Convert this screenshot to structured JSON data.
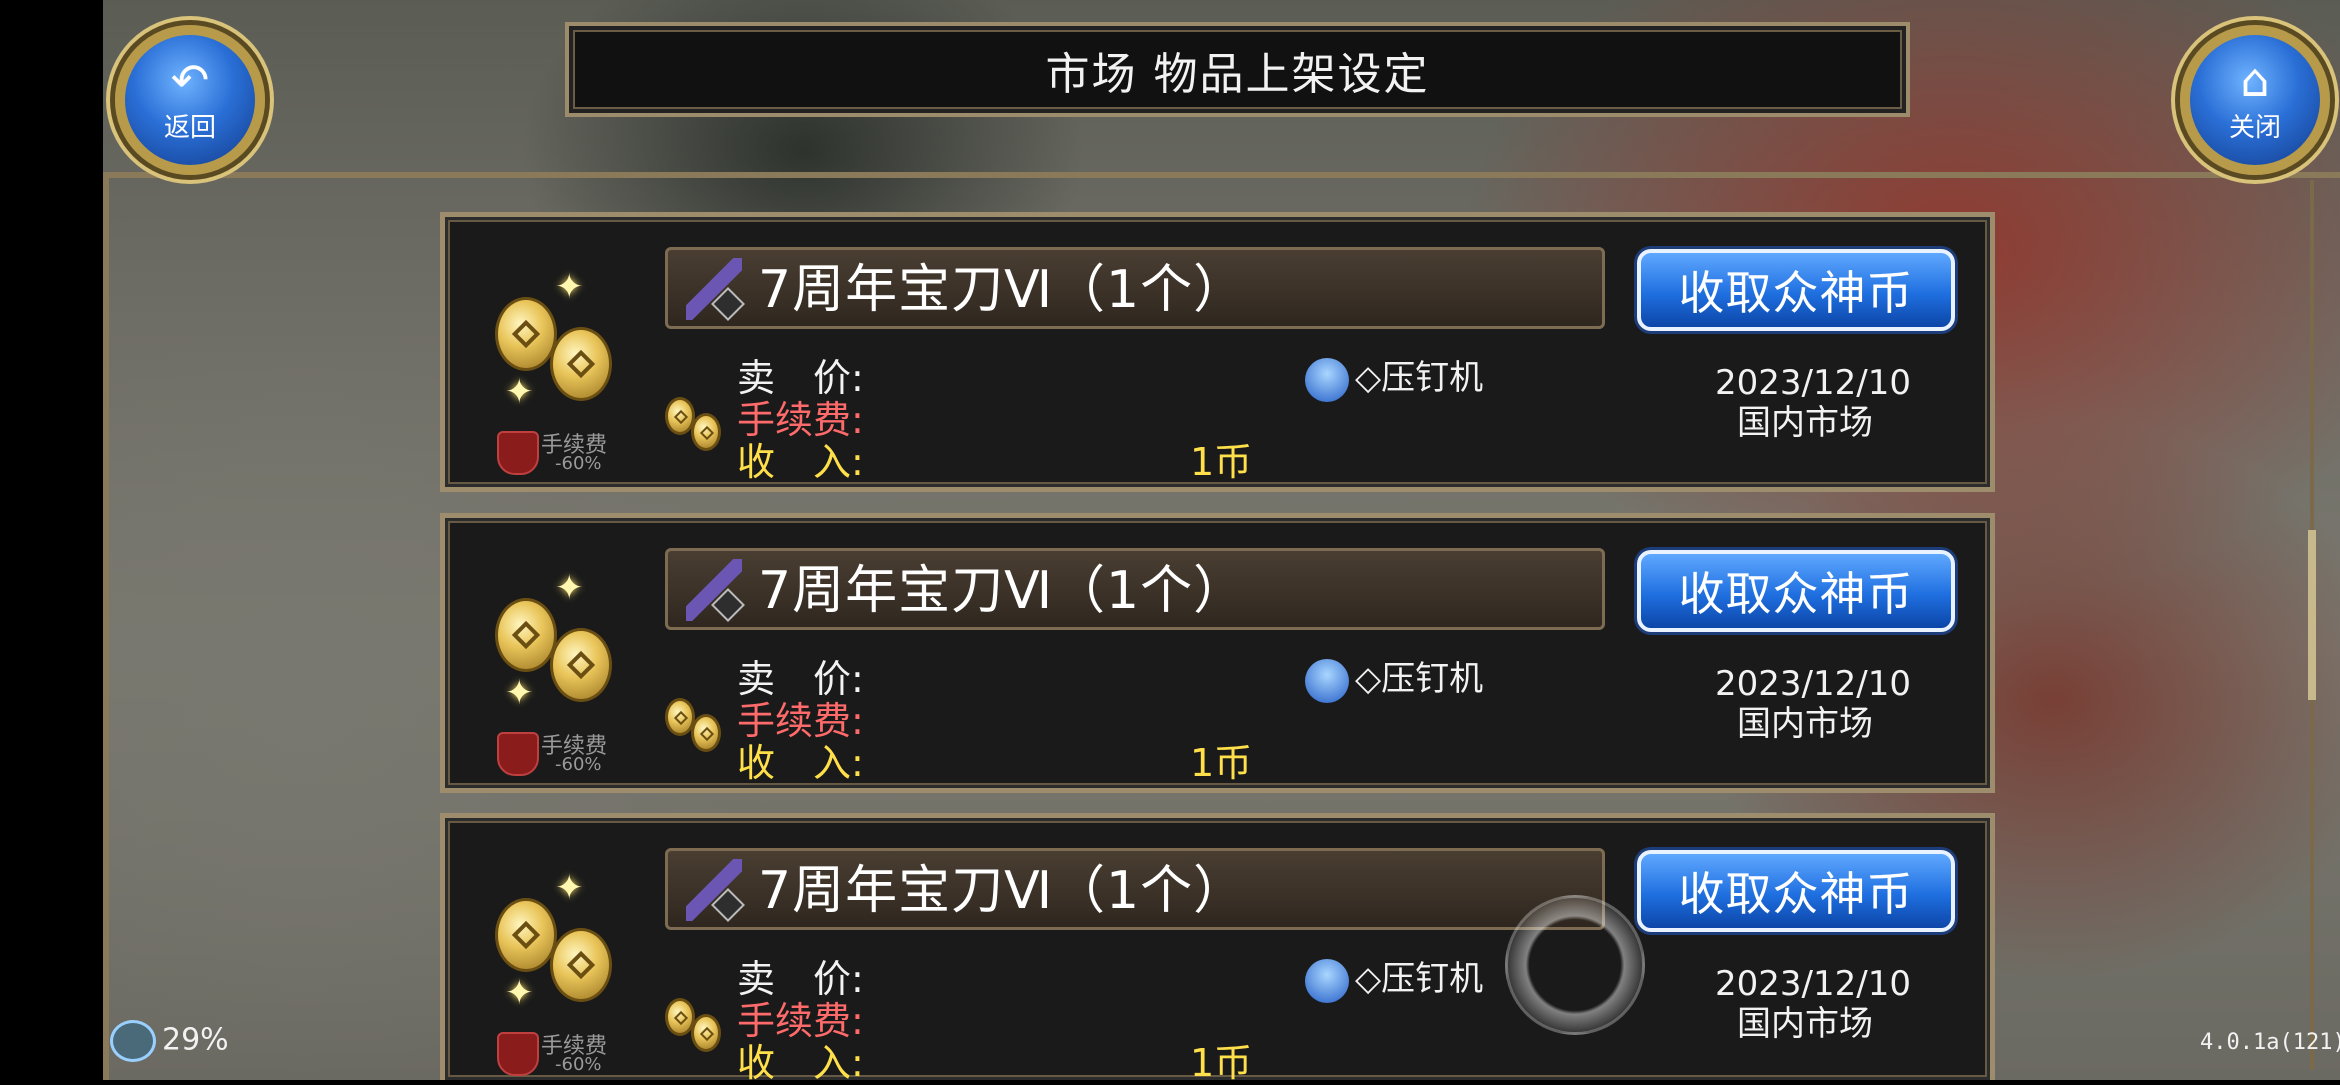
{
  "header": {
    "title": "市场 物品上架设定",
    "back_label": "返回",
    "close_label": "关闭"
  },
  "listings": [
    {
      "item_name": "7周年宝刀Ⅵ（1个）",
      "price_label": "卖　价:",
      "fee_label": "手续费:",
      "income_label": "收　入:",
      "income_value": "1币",
      "seller": "◇压钉机",
      "date": "2023/12/10",
      "market": "国内市场",
      "collect_label": "收取众神币",
      "fee_badge_title": "手续费",
      "fee_badge_value": "-60%"
    },
    {
      "item_name": "7周年宝刀Ⅵ（1个）",
      "price_label": "卖　价:",
      "fee_label": "手续费:",
      "income_label": "收　入:",
      "income_value": "1币",
      "seller": "◇压钉机",
      "date": "2023/12/10",
      "market": "国内市场",
      "collect_label": "收取众神币",
      "fee_badge_title": "手续费",
      "fee_badge_value": "-60%"
    },
    {
      "item_name": "7周年宝刀Ⅵ（1个）",
      "price_label": "卖　价:",
      "fee_label": "手续费:",
      "income_label": "收　入:",
      "income_value": "1币",
      "seller": "◇压钉机",
      "date": "2023/12/10",
      "market": "国内市场",
      "collect_label": "收取众神币",
      "fee_badge_title": "手续费",
      "fee_badge_value": "-60%"
    }
  ],
  "status": {
    "battery": "29%",
    "version": "4.0.1a(121)"
  },
  "colors": {
    "accent_blue": "#1f6fe0",
    "fee_red": "#ff6a6a",
    "income_yellow": "#ffe04a",
    "frame_gold": "#9e8d6c"
  }
}
